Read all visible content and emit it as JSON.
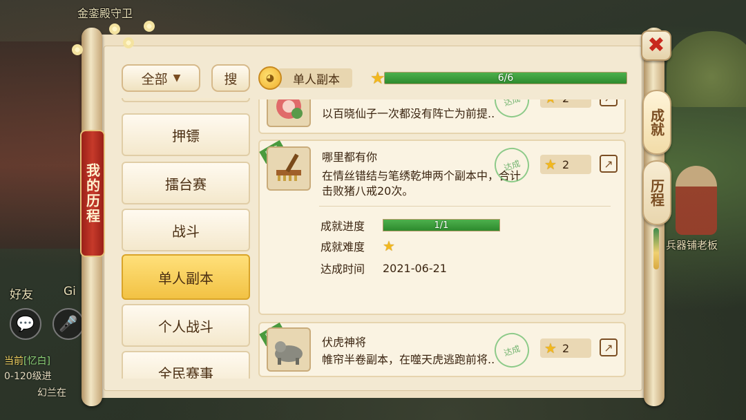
{
  "world": {
    "top_label": "金銮殿守卫",
    "right_label": "兵器铺老板",
    "friends_label": "好友",
    "gi_label": "Gi",
    "chat_lines": [
      {
        "tag": "当前",
        "text": "[忆白]"
      },
      {
        "tag": "",
        "text": "0-120级进"
      },
      {
        "tag": "",
        "text": "幻兰在"
      }
    ]
  },
  "ribbon": {
    "label": "我的历程"
  },
  "close": {
    "icon": "close-icon"
  },
  "side_tabs": [
    {
      "label": "成就",
      "active": true
    },
    {
      "label": "历程",
      "active": false
    }
  ],
  "toolbar": {
    "filter_label": "全部",
    "search_label": "搜"
  },
  "category_header": {
    "label": "单人副本",
    "progress_text": "6/6",
    "progress": 1.0
  },
  "categories": [
    {
      "label": "押镖"
    },
    {
      "label": "擂台赛"
    },
    {
      "label": "战斗"
    },
    {
      "label": "单人副本",
      "active": true
    },
    {
      "label": "个人战斗"
    },
    {
      "label": "全民赛事"
    }
  ],
  "achievements": [
    {
      "desc": "以百晓仙子一次都没有阵亡为前提..",
      "points": "2",
      "stamp": "达成"
    },
    {
      "title": "哪里都有你",
      "desc": "在情丝错结与笔绣乾坤两个副本中，合计击败猪八戒20次。",
      "points": "2",
      "stamp": "达成",
      "hidden_tag": "隐藏",
      "detail": {
        "progress_label": "成就进度",
        "progress_text": "1/1",
        "progress": 1.0,
        "difficulty_label": "成就难度",
        "difficulty_stars": 1,
        "date_label": "达成时间",
        "date": "2021-06-21"
      }
    },
    {
      "title": "伏虎神将",
      "desc": "帷帘半卷副本，在噬天虎逃跑前将..",
      "points": "2",
      "stamp": "达成",
      "hidden_tag": "隐藏"
    }
  ],
  "colors": {
    "accent_gold": "#f2c244",
    "progress_green": "#2e8a2e",
    "ribbon_red": "#c63a2a",
    "close_red": "#c8281e"
  }
}
